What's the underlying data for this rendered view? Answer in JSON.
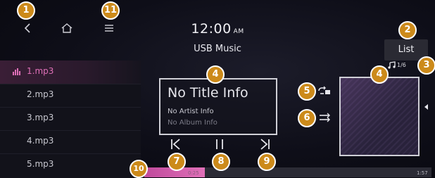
{
  "status_bar": {
    "time": "12:00",
    "ampm": "AM"
  },
  "header": {
    "title": "USB Music",
    "list_label": "List"
  },
  "playlist": {
    "items": [
      {
        "label": "1.mp3",
        "active": true
      },
      {
        "label": "2.mp3",
        "active": false
      },
      {
        "label": "3.mp3",
        "active": false
      },
      {
        "label": "4.mp3",
        "active": false
      },
      {
        "label": "5.mp3",
        "active": false
      }
    ]
  },
  "now_playing": {
    "title": "No Title Info",
    "artist": "No Artist Info",
    "album": "No Album Info",
    "track_count": "1/6"
  },
  "progress": {
    "elapsed": "0:25",
    "duration": "1:57",
    "fraction": 0.21
  },
  "callouts": {
    "c1": "1",
    "c2": "2",
    "c3": "3",
    "c4a": "4",
    "c4b": "4",
    "c5": "5",
    "c6": "6",
    "c7": "7",
    "c8": "8",
    "c9": "9",
    "c10": "10",
    "c11": "11"
  },
  "colors": {
    "accent": "#e070b8",
    "callout": "#cc8a1a"
  },
  "icons": {
    "back": "back-chevron-icon",
    "home": "home-icon",
    "menu": "menu-icon",
    "repeat": "repeat-icon",
    "shuffle": "shuffle-icon",
    "previous": "previous-track-icon",
    "pause": "pause-icon",
    "next": "next-track-icon",
    "note": "music-note-icon",
    "equalizer": "equalizer-icon"
  }
}
